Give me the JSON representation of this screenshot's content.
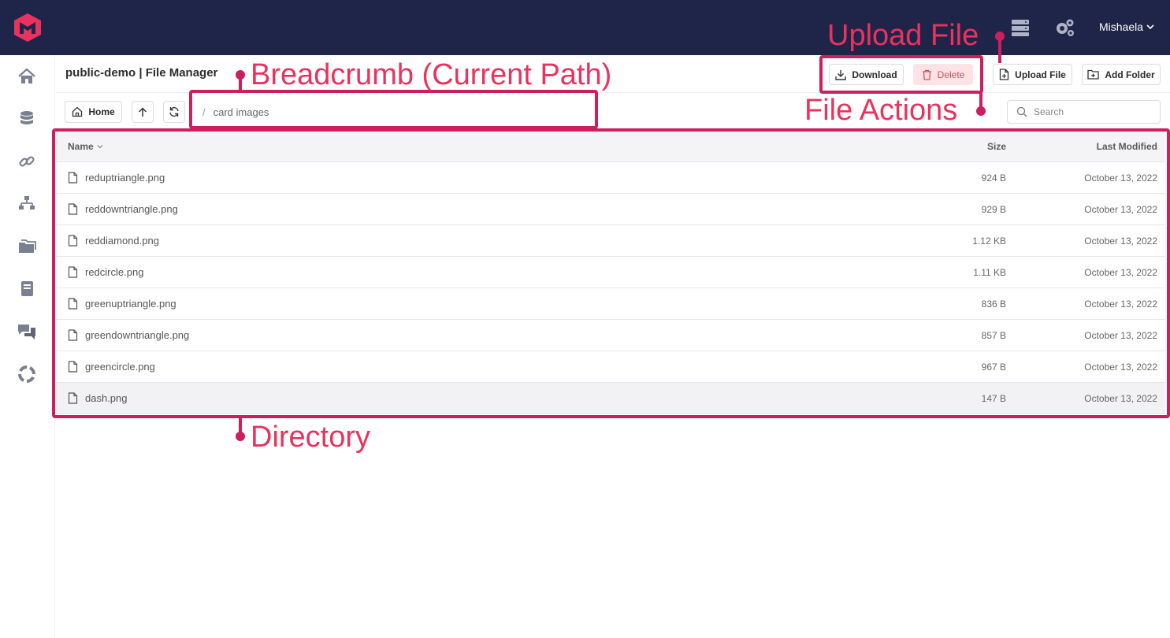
{
  "header": {
    "logo": "m-logo-icon",
    "user_name": "Mishaela",
    "icons": [
      "server-icon",
      "gears-icon",
      "chevron-down-icon"
    ]
  },
  "sidebar": {
    "items": [
      "home-icon",
      "database-icon",
      "link-icon",
      "sitemap-icon",
      "folders-icon",
      "book-icon",
      "comments-icon",
      "lifering-icon"
    ]
  },
  "page": {
    "title": "public-demo | File Manager",
    "buttons": {
      "download": "Download",
      "delete": "Delete",
      "upload": "Upload File",
      "add_folder": "Add Folder",
      "home": "Home"
    },
    "path": {
      "separator": "/",
      "current": "card images"
    },
    "search_placeholder": "Search"
  },
  "table": {
    "columns": {
      "name": "Name",
      "size": "Size",
      "modified": "Last Modified"
    },
    "rows": [
      {
        "name": "reduptriangle.png",
        "size": "924 B",
        "modified": "October 13, 2022"
      },
      {
        "name": "reddowntriangle.png",
        "size": "929 B",
        "modified": "October 13, 2022"
      },
      {
        "name": "reddiamond.png",
        "size": "1.12 KB",
        "modified": "October 13, 2022"
      },
      {
        "name": "redcircle.png",
        "size": "1.11 KB",
        "modified": "October 13, 2022"
      },
      {
        "name": "greenuptriangle.png",
        "size": "836 B",
        "modified": "October 13, 2022"
      },
      {
        "name": "greendowntriangle.png",
        "size": "857 B",
        "modified": "October 13, 2022"
      },
      {
        "name": "greencircle.png",
        "size": "967 B",
        "modified": "October 13, 2022"
      },
      {
        "name": "dash.png",
        "size": "147 B",
        "modified": "October 13, 2022"
      }
    ]
  },
  "annotations": {
    "breadcrumb": "Breadcrumb (Current Path)",
    "file_actions": "File Actions",
    "upload_file": "Upload File",
    "directory": "Directory"
  },
  "colors": {
    "topbar": "#1e2549",
    "annotation": "#e8335f",
    "annotation_frame": "#cc1f5d",
    "delete_bg": "#fde3e6",
    "delete_text": "#e14b5a"
  }
}
